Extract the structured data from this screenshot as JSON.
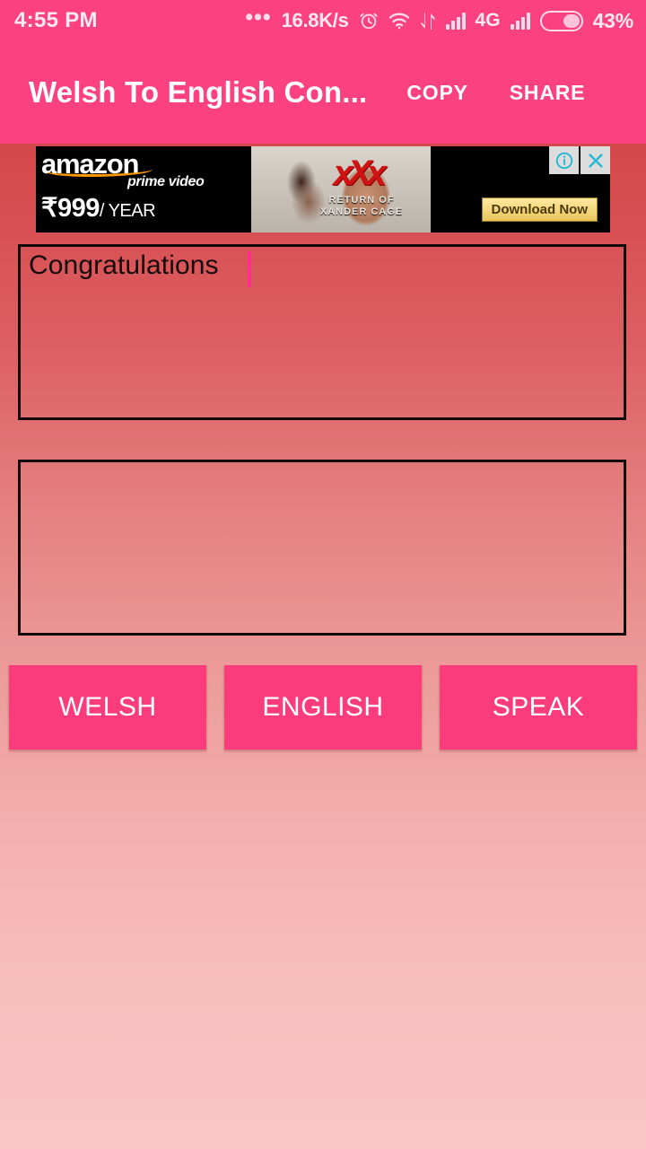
{
  "status_bar": {
    "clock": "4:55 PM",
    "overflow_dots": "•••",
    "network_speed": "16.8K/s",
    "alarm_icon": "alarm-clock-icon",
    "wifi_icon": "wifi-icon",
    "data_transfer_icon": "data-transfer-icon",
    "signal_icon": "signal-bars-icon",
    "network_type": "4G",
    "signal2_icon": "signal-bars-icon-2",
    "battery_icon": "battery-icon",
    "battery_percent": "43%",
    "background_color": "#FB4180",
    "text_color": "#FFE9F1"
  },
  "app_bar": {
    "title": "Welsh To English Con...",
    "copy_label": "COPY",
    "share_label": "SHARE",
    "background_color": "#FB4180"
  },
  "ad": {
    "brand": "amazon",
    "brand_tagline": "prime video",
    "price": "₹999",
    "price_period": "/ YEAR",
    "movie_logo": "xXx",
    "movie_subtitle": "RETURN OF\nXANDER CAGE",
    "cta_label": "Download Now",
    "info_icon": "adchoices-info-icon",
    "close_icon": "ad-close-icon",
    "info_glyph": "i",
    "close_glyph": "✕"
  },
  "translator": {
    "input_text": "Congratulations",
    "input_placeholder": "",
    "output_text": "",
    "output_placeholder": "",
    "caret_visible": true
  },
  "buttons": {
    "source_language": "WELSH",
    "target_language": "ENGLISH",
    "speak": "SPEAK",
    "color": "#FB3C7C"
  },
  "theme": {
    "accent_pink": "#FB4180",
    "background_top": "#CF3A3E",
    "background_bottom": "#FBC6C4",
    "border_color": "#120A0A",
    "caret_color": "#FF2F8F"
  }
}
